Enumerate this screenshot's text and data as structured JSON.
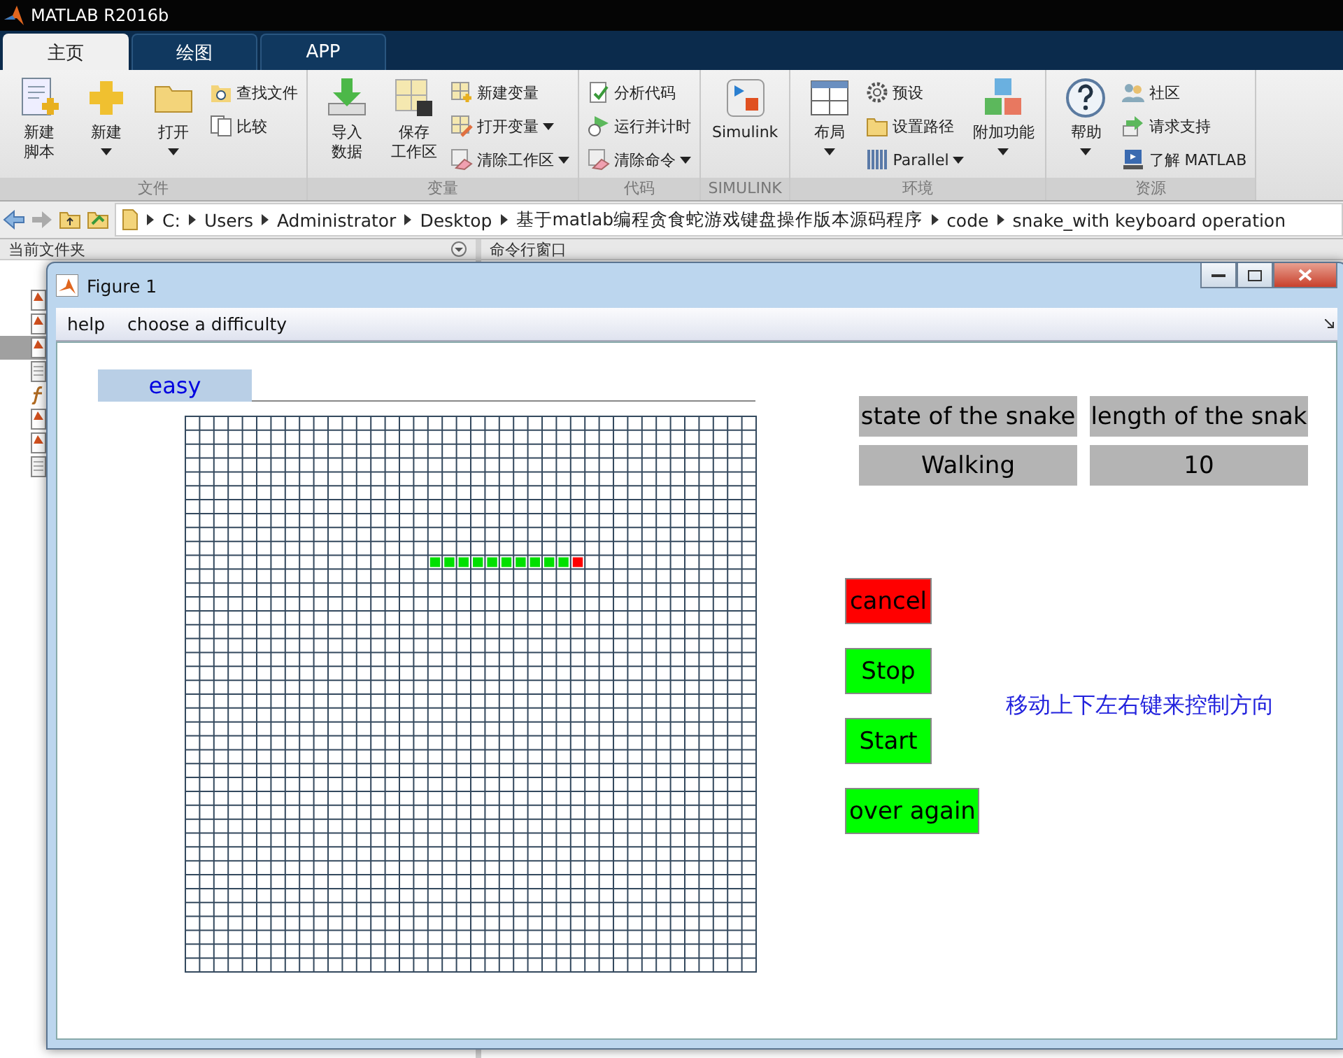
{
  "app_title": "MATLAB R2016b",
  "ribbon_tabs": [
    {
      "label": "主页",
      "selected": true
    },
    {
      "label": "绘图",
      "selected": false
    },
    {
      "label": "APP",
      "selected": false
    }
  ],
  "ribbon_groups": [
    {
      "label": "文件",
      "items": [
        {
          "kind": "large",
          "lines": [
            "新建",
            "脚本"
          ],
          "dropdown": false
        },
        {
          "kind": "large",
          "lines": [
            "新建"
          ],
          "dropdown": true
        },
        {
          "kind": "large",
          "lines": [
            "打开"
          ],
          "dropdown": true
        },
        {
          "kind": "stack",
          "entries": [
            {
              "label": "查找文件",
              "dropdown": false
            },
            {
              "label": "比较",
              "dropdown": false
            }
          ]
        }
      ]
    },
    {
      "label": "变量",
      "items": [
        {
          "kind": "large",
          "lines": [
            "导入",
            "数据"
          ],
          "dropdown": false
        },
        {
          "kind": "large",
          "lines": [
            "保存",
            "工作区"
          ],
          "dropdown": false
        },
        {
          "kind": "stack",
          "entries": [
            {
              "label": "新建变量",
              "dropdown": false
            },
            {
              "label": "打开变量",
              "dropdown": true
            },
            {
              "label": "清除工作区",
              "dropdown": true
            }
          ]
        }
      ]
    },
    {
      "label": "代码",
      "items": [
        {
          "kind": "stack",
          "entries": [
            {
              "label": "分析代码",
              "dropdown": false
            },
            {
              "label": "运行并计时",
              "dropdown": false
            },
            {
              "label": "清除命令",
              "dropdown": true
            }
          ]
        }
      ]
    },
    {
      "label": "SIMULINK",
      "items": [
        {
          "kind": "large",
          "lines": [
            "Simulink"
          ],
          "dropdown": false
        }
      ]
    },
    {
      "label": "环境",
      "items": [
        {
          "kind": "large",
          "lines": [
            "布局"
          ],
          "dropdown": true
        },
        {
          "kind": "stack",
          "entries": [
            {
              "label": "预设",
              "dropdown": false
            },
            {
              "label": "设置路径",
              "dropdown": false
            },
            {
              "label": "Parallel",
              "dropdown": true
            }
          ]
        },
        {
          "kind": "large",
          "lines": [
            "附加功能"
          ],
          "dropdown": true
        }
      ]
    },
    {
      "label": "资源",
      "items": [
        {
          "kind": "large",
          "lines": [
            "帮助"
          ],
          "dropdown": true
        },
        {
          "kind": "stack",
          "entries": [
            {
              "label": "社区",
              "dropdown": false
            },
            {
              "label": "请求支持",
              "dropdown": false
            },
            {
              "label": "了解 MATLAB",
              "dropdown": false
            }
          ]
        }
      ]
    }
  ],
  "path": [
    "C:",
    "Users",
    "Administrator",
    "Desktop",
    "基于matlab编程贪食蛇游戏键盘操作版本源码程序",
    "code",
    "snake_with keyboard operation"
  ],
  "current_folder": {
    "title": "当前文件夹",
    "files": [
      {
        "kind": "mfile",
        "selected": false
      },
      {
        "kind": "mfile",
        "selected": false
      },
      {
        "kind": "mfile",
        "selected": true
      },
      {
        "kind": "text",
        "selected": false
      },
      {
        "kind": "function",
        "selected": false
      },
      {
        "kind": "mfile",
        "selected": false
      },
      {
        "kind": "mfile",
        "selected": false
      },
      {
        "kind": "text",
        "selected": false
      }
    ]
  },
  "command_window": {
    "title": "命令行窗口"
  },
  "figure": {
    "title": "Figure 1",
    "menu": [
      "help",
      "choose a difficulty"
    ],
    "difficulty": "easy",
    "status_headers": [
      "state of the snake",
      "length of the snak"
    ],
    "status_values": [
      "Walking",
      "10"
    ],
    "buttons": [
      {
        "label": "cancel",
        "color": "#ff0000"
      },
      {
        "label": "Stop",
        "color": "#00ff00"
      },
      {
        "label": "Start",
        "color": "#00ff00"
      },
      {
        "label": "over again",
        "color": "#00ff00"
      }
    ],
    "hint": "移动上下左右键来控制方向"
  }
}
